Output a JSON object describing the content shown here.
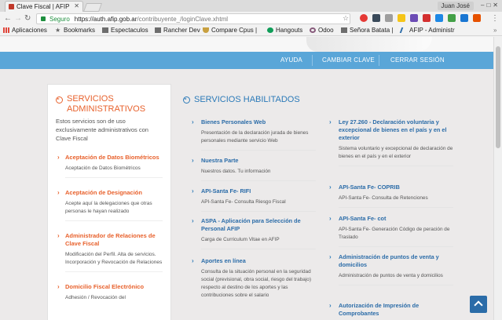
{
  "browser": {
    "tab_title": "Clave Fiscal | AFIP",
    "user_name": "Juan José",
    "url_secure_label": "Seguro",
    "url_host": "https://auth.afip.gob.ar",
    "url_path": "/contribuyente_/loginClave.xhtml",
    "bookmarks": [
      {
        "label": "Aplicaciones",
        "icon": "apps-grid-icon"
      },
      {
        "label": "Bookmarks",
        "icon": "star-icon"
      },
      {
        "label": "Espectaculos",
        "icon": "folder-icon"
      },
      {
        "label": "Rancher Dev",
        "icon": "folder-icon"
      },
      {
        "label": "Compare Cpus |",
        "icon": "shield-icon"
      },
      {
        "label": "Hangouts",
        "icon": "hangouts-icon"
      },
      {
        "label": "Odoo",
        "icon": "odoo-icon"
      },
      {
        "label": "Señora Batata |",
        "icon": "folder-icon"
      },
      {
        "label": "AFIP - Administr",
        "icon": "afip-icon"
      }
    ]
  },
  "nav": {
    "ayuda": "AYUDA",
    "cambiar_clave": "CAMBIAR CLAVE",
    "cerrar_sesion": "CERRAR SESIÓN"
  },
  "sidebar": {
    "title_line1": "SERVICIOS",
    "title_line2": "ADMINISTRATIVOS",
    "description": "Estos servicios son de uso exclusivamente administrativos con Clave Fiscal",
    "items": [
      {
        "title": "Aceptación de Datos Biométricos",
        "desc": "Aceptación de Datos Biométricos"
      },
      {
        "title": "Aceptación de Designación",
        "desc": "Acepte aquí la delegaciones que otras personas le hayan realizado"
      },
      {
        "title": "Administrador de Relaciones de Clave Fiscal",
        "desc": "Modificación del Perfil. Alta de servicios. Incorporación y Revocación de Relaciones"
      },
      {
        "title": "Domicilio Fiscal Electrónico",
        "desc": "Adhesión / Revocación del"
      }
    ]
  },
  "main": {
    "title": "SERVICIOS HABILITADOS",
    "left_col": [
      {
        "title": "Bienes Personales Web",
        "desc": "Presentación de la declaración jurada de bienes personales mediante servicio Web"
      },
      {
        "title": "Nuestra Parte",
        "desc": "Nuestros datos. Tu información"
      },
      {
        "title": "API-Santa Fe- RIFI",
        "desc": "API-Santa Fe- Consulta Riesgo Fiscal"
      },
      {
        "title": "ASPA - Aplicación para Selección de Personal AFIP",
        "desc": "Carga de Curriculum Vitae en AFIP"
      },
      {
        "title": "Aportes en línea",
        "desc": "Consulta de la situación personal en la seguridad social (previsional, obra social, riesgo del trabajo) respecto al destino de los aportes y las contribuciones sobre el salario"
      }
    ],
    "right_col": [
      {
        "title": "Ley 27.260 - Declaración voluntaria y excepcional de bienes en el país y en el exterior",
        "desc": "Sistema voluntario y excepcional de declaración de bienes en el país y en el exterior"
      },
      {
        "title": "API-Santa Fe- COPRIB",
        "desc": "API-Santa Fe- Consulta de Retenciones"
      },
      {
        "title": "API-Santa Fe- cot",
        "desc": "API-Santa Fe- Generación Código de peración de Traslado"
      },
      {
        "title": "Administración de puntos de venta y domicilios",
        "desc": "Administración de puntos de venta y domicilios"
      },
      {
        "title": "Autorización de Impresión de Comprobantes",
        "desc": ""
      }
    ]
  }
}
